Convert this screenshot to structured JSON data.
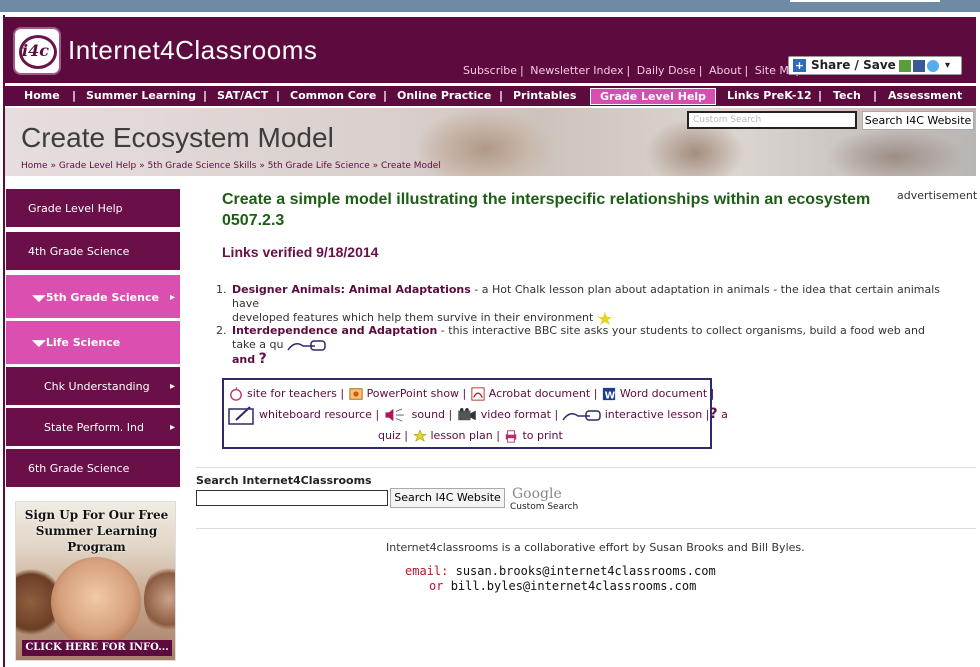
{
  "header": {
    "logo_text": "i4c",
    "site_title": "Internet4Classrooms",
    "top_links": [
      "Subscribe",
      "Newsletter Index",
      "Daily Dose",
      "About",
      "Site Map"
    ],
    "share_label": "Share / Save"
  },
  "nav": {
    "items": [
      "Home",
      "Summer Learning",
      "SAT/ACT",
      "Common Core",
      "Online Practice",
      "Printables",
      "Grade Level Help",
      "Links PreK-12",
      "Tech",
      "Assessment"
    ],
    "active": "Grade Level Help"
  },
  "banner": {
    "title": "Create Ecosystem Model",
    "breadcrumbs": [
      "Home",
      "Grade Level Help",
      "5th Grade Science Skills",
      "5th Grade Life Science",
      "Create Model"
    ],
    "search_placeholder": "Custom Search",
    "search_button": "Search I4C Website"
  },
  "sidebar": {
    "items": [
      {
        "label": "Grade Level Help"
      },
      {
        "label": "4th Grade Science"
      },
      {
        "label": "5th Grade Science"
      },
      {
        "label": "Life Science"
      },
      {
        "label": "Chk Understanding"
      },
      {
        "label": "State Perform. Ind"
      },
      {
        "label": "6th Grade Science"
      }
    ],
    "promo": {
      "headline": "Sign Up For Our Free Summer Learning Program",
      "cta": "CLICK HERE FOR INFO..."
    }
  },
  "main": {
    "title": "Create a simple model illustrating the interspecific relationships within an ecosystem 0507.2.3",
    "advertisement": "advertisement",
    "verified": "Links verified 9/18/2014",
    "links": [
      {
        "num": "1.",
        "title": "Designer Animals: Animal Adaptations",
        "desc_line1": " - a Hot Chalk lesson plan about adaptation in animals - the idea that certain animals have",
        "desc_line2": "developed features which help them survive in their environment"
      },
      {
        "num": "2.",
        "title": "Interdependence and Adaptation",
        "desc_line1": "  - this interactive BBC site asks your students to collect organisms, build a food web and take a qu",
        "desc_line2": "and"
      }
    ],
    "legend": {
      "site_for_teachers": "site for teachers",
      "powerpoint": "PowerPoint show",
      "acrobat": "Acrobat document",
      "word": "Word document",
      "whiteboard": "whiteboard resource",
      "sound": "sound",
      "video": "video format",
      "interactive": "interactive lesson",
      "a": "a",
      "quiz": "quiz",
      "lesson_plan": "lesson plan",
      "print": "to print"
    }
  },
  "search": {
    "label": "Search Internet4Classrooms",
    "button": "Search I4C Website",
    "google": "Google",
    "custom": "Custom Search"
  },
  "footer": {
    "credit": "Internet4classrooms is a collaborative effort by Susan Brooks and Bill Byles.",
    "email_label": "email:",
    "email1": "susan.brooks@internet4classrooms.com",
    "or": "or",
    "email2": "bill.byles@internet4classrooms.com"
  },
  "colors": {
    "brand": "#5d0b3e",
    "accent_pink": "#db4fb0",
    "title_green": "#1c5e14"
  }
}
